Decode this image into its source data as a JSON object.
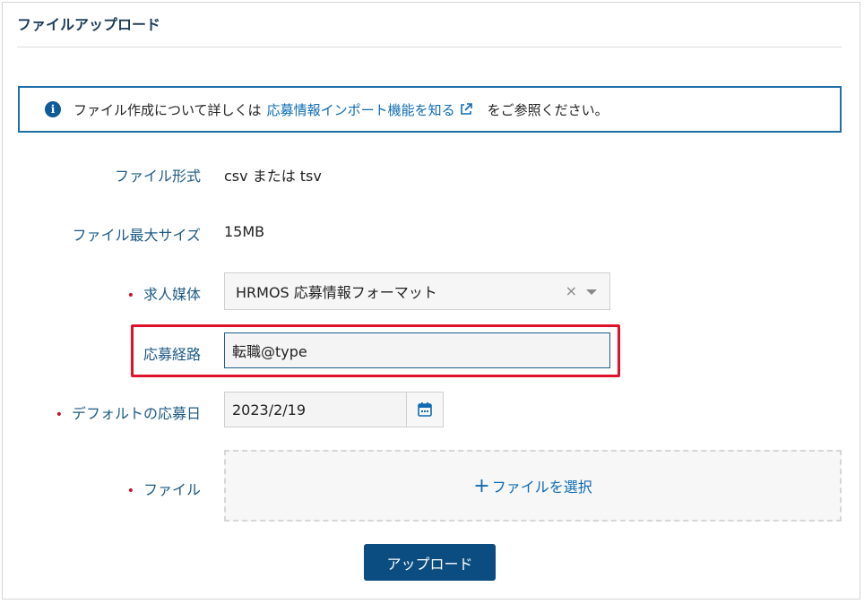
{
  "header": {
    "title": "ファイルアップロード"
  },
  "info": {
    "prefix": "ファイル作成について詳しくは",
    "link_text": "応募情報インポート機能を知る",
    "suffix": "をご参照ください。"
  },
  "form": {
    "file_format": {
      "label": "ファイル形式",
      "value": "csv または tsv"
    },
    "max_size": {
      "label": "ファイル最大サイズ",
      "value": "15MB"
    },
    "media": {
      "required_mark": "•",
      "label": "求人媒体",
      "value": "HRMOS 応募情報フォーマット",
      "clear": "×"
    },
    "route": {
      "label": "応募経路",
      "value": "転職@type"
    },
    "default_date": {
      "required_mark": "•",
      "label": "デフォルトの応募日",
      "value": "2023/2/19"
    },
    "file": {
      "required_mark": "•",
      "label": "ファイル",
      "plus": "+",
      "select_text": "ファイルを選択"
    }
  },
  "actions": {
    "upload_label": "アップロード"
  },
  "colors": {
    "accent": "#0b4d80",
    "link": "#0e6cb5",
    "required": "#c8102e",
    "highlight": "#e0112b"
  }
}
